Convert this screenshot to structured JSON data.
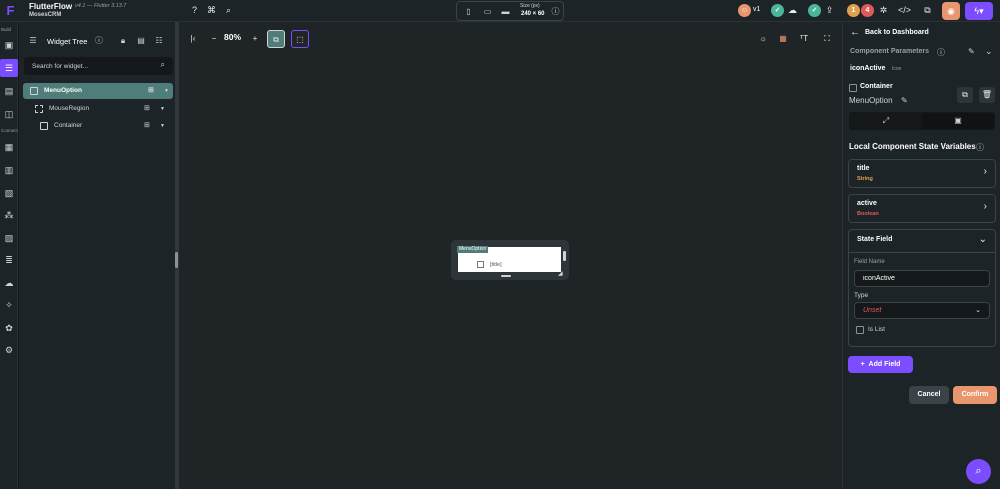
{
  "topbar": {
    "app_name": "FlutterFlow",
    "version": "v4.1 — Flutter 3.13.7",
    "project_name": "MosesCRM",
    "size_label": "Size (px)",
    "size_value": "240 × 60",
    "version_badge": "v1",
    "notif_count": "4",
    "warning_count": "1"
  },
  "rail": {
    "build_label": "Build",
    "connect_label": "Connect"
  },
  "tree": {
    "title": "Widget Tree",
    "search_placeholder": "Search for widget...",
    "nodes": [
      {
        "label": "MenuOption"
      },
      {
        "label": "MouseRegion"
      },
      {
        "label": "Container"
      }
    ]
  },
  "canvas": {
    "zoom": "80%",
    "preview_tag": "MenuOption",
    "preview_title": "[title]"
  },
  "props": {
    "back_label": "Back to Dashboard",
    "section_title": "Component Parameters",
    "param_name": "iconActive",
    "param_type": "Icon",
    "widget_type": "Container",
    "widget_name": "MenuOption",
    "state_title": "Local Component State Variables",
    "fields": [
      {
        "name": "title",
        "type": "String",
        "type_color": "#e0a14e"
      },
      {
        "name": "active",
        "type": "Boolean",
        "type_color": "#e05a5a"
      }
    ],
    "state_field": {
      "header": "State Field",
      "field_name_label": "Field Name",
      "field_name_value": "iconActive",
      "type_label": "Type",
      "type_value": "Unset",
      "is_list_label": "Is List"
    },
    "add_field_label": "Add Field",
    "cancel_label": "Cancel",
    "confirm_label": "Confirm"
  },
  "colors": {
    "accent": "#7c4dff",
    "selected_node": "#4f7d7a",
    "confirm": "#e9956d",
    "unset_text": "#e05a5a"
  }
}
